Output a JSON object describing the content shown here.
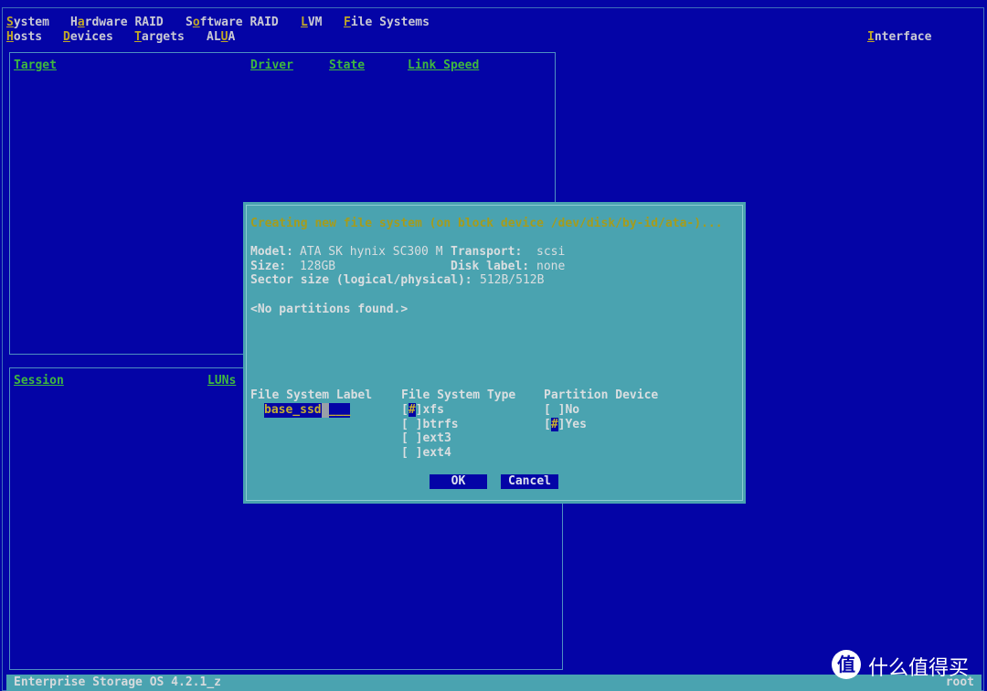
{
  "menu": {
    "row1": [
      {
        "label": "System",
        "hotkey": 0
      },
      {
        "label": "Hardware RAID",
        "hotkey": 1
      },
      {
        "label": "Software RAID",
        "hotkey": 1
      },
      {
        "label": "LVM",
        "hotkey": 0
      },
      {
        "label": "File Systems",
        "hotkey": 0
      }
    ],
    "row2": [
      {
        "label": "Hosts",
        "hotkey": 0
      },
      {
        "label": "Devices",
        "hotkey": 0
      },
      {
        "label": "Targets",
        "hotkey": 0
      },
      {
        "label": "ALUA",
        "hotkey": 2
      }
    ],
    "interface": {
      "label": "Interface",
      "hotkey": 0
    }
  },
  "targets_panel": {
    "columns": [
      "Target",
      "Driver",
      "State",
      "Link Speed"
    ]
  },
  "sessions_panel": {
    "columns": [
      "Session",
      "LUNs"
    ]
  },
  "dialog": {
    "title": "Creating new file system (on block device /dev/disk/by-id/ata-)...",
    "model_label": "Model:",
    "model": "ATA SK hynix SC300 M",
    "transport_label": "Transport:",
    "transport": "scsi",
    "size_label": "Size:",
    "size": "128GB",
    "disk_label_label": "Disk label:",
    "disk_label": "none",
    "sector_label": "Sector size (logical/physical):",
    "sector": "512B/512B",
    "partitions_note": "<No partitions found.>",
    "fs_label_heading": "File System Label",
    "fs_label_value": "base_ssd",
    "fs_label_fill": "___",
    "fs_type_heading": "File System Type",
    "fs_types": [
      {
        "label": "xfs",
        "checked": true
      },
      {
        "label": "btrfs",
        "checked": false
      },
      {
        "label": "ext3",
        "checked": false
      },
      {
        "label": "ext4",
        "checked": false
      }
    ],
    "partition_heading": "Partition Device",
    "partition_options": [
      {
        "label": "No",
        "checked": false
      },
      {
        "label": "Yes",
        "checked": true
      }
    ],
    "ok_label": "OK",
    "cancel_label": "Cancel"
  },
  "status": {
    "left": "Enterprise Storage OS 4.2.1_z",
    "right": "root"
  },
  "watermark": {
    "text": "什么值得买",
    "logo": "值"
  },
  "colors": {
    "background": "#0404a6",
    "dialog": "#4aa3b0",
    "hotkey": "#c0a828",
    "header": "#3fb83f"
  }
}
